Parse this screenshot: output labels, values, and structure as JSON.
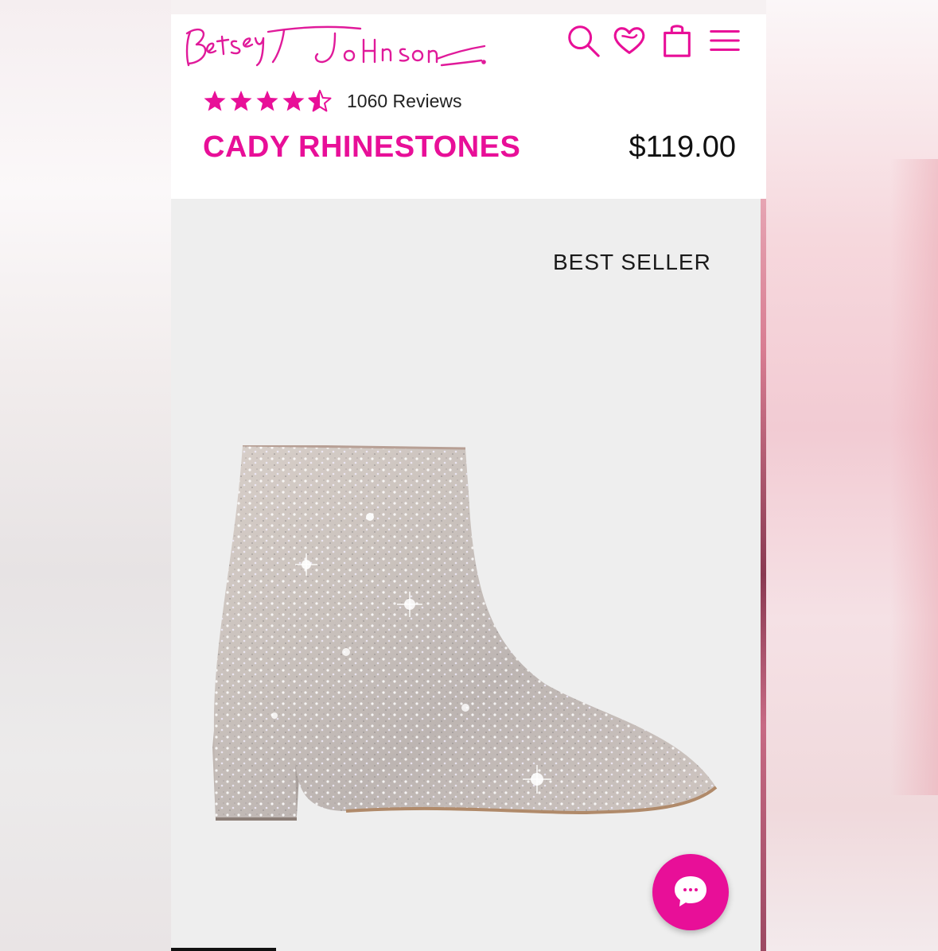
{
  "header": {
    "logo_text": "Betsey Johnson",
    "icons": [
      "search-icon",
      "heart-icon",
      "shopping-bag-icon",
      "hamburger-menu-icon"
    ]
  },
  "product": {
    "rating": 4.5,
    "rating_max": 5,
    "reviews_label": "1060 Reviews",
    "name": "CADY RHINESTONES",
    "price": "$119.00",
    "badge": "BEST SELLER"
  },
  "chat": {
    "icon": "chat-bubble-icon"
  },
  "colors": {
    "brand_pink": "#e80f98",
    "text_dark": "#111111",
    "image_background": "#eeeeee"
  }
}
